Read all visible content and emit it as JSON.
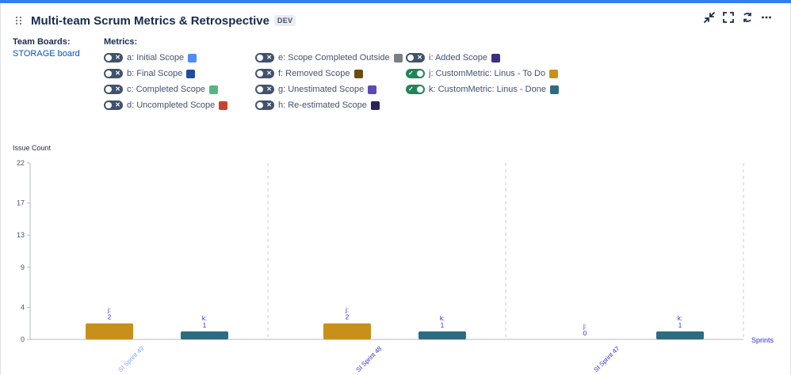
{
  "header": {
    "title": "Multi-team Scrum Metrics & Retrospective",
    "badge": "DEV"
  },
  "team_boards": {
    "label": "Team Boards:",
    "boards": [
      "STORAGE board"
    ]
  },
  "metrics": {
    "label": "Metrics:",
    "columns": [
      [
        {
          "label": "a: Initial Scope",
          "on": false,
          "color": "#4c8df6"
        },
        {
          "label": "b: Final Scope",
          "on": false,
          "color": "#1f4e9e"
        },
        {
          "label": "c: Completed Scope",
          "on": false,
          "color": "#57b584"
        },
        {
          "label": "d: Uncompleted Scope",
          "on": false,
          "color": "#c9402c"
        }
      ],
      [
        {
          "label": "e: Scope Completed Outside",
          "on": false,
          "color": "#7a7f85"
        },
        {
          "label": "f: Removed Scope",
          "on": false,
          "color": "#6b4d0f"
        },
        {
          "label": "g: Unestimated Scope",
          "on": false,
          "color": "#5e4ab2"
        },
        {
          "label": "h: Re-estimated Scope",
          "on": false,
          "color": "#2a2554"
        }
      ],
      [
        {
          "label": "i: Added Scope",
          "on": false,
          "color": "#3f2f80"
        },
        {
          "label": "j: CustomMetric: Linus - To Do",
          "on": true,
          "color": "#c8901b"
        },
        {
          "label": "k: CustomMetric: Linus - Done",
          "on": true,
          "color": "#2d6c80"
        }
      ]
    ]
  },
  "chart_data": {
    "type": "bar",
    "ylabel": "Issue Count",
    "xlabel": "Sprints",
    "ylim": [
      0,
      22
    ],
    "yticks": [
      0,
      4,
      9,
      13,
      17,
      22
    ],
    "categories": [
      "SI Sprint 49",
      "SI Sprint 48",
      "SI Sprint 47"
    ],
    "series": [
      {
        "name": "j",
        "values": [
          2,
          2,
          0
        ],
        "color": "#c8901b"
      },
      {
        "name": "k",
        "values": [
          1,
          1,
          1
        ],
        "color": "#2d6c80"
      }
    ],
    "data_label_color": "#2d2dd8",
    "category_label_colors": [
      "#7fa8e8",
      "#2d2dd8",
      "#2d2dd8"
    ],
    "grid": "vertical-dashed"
  }
}
